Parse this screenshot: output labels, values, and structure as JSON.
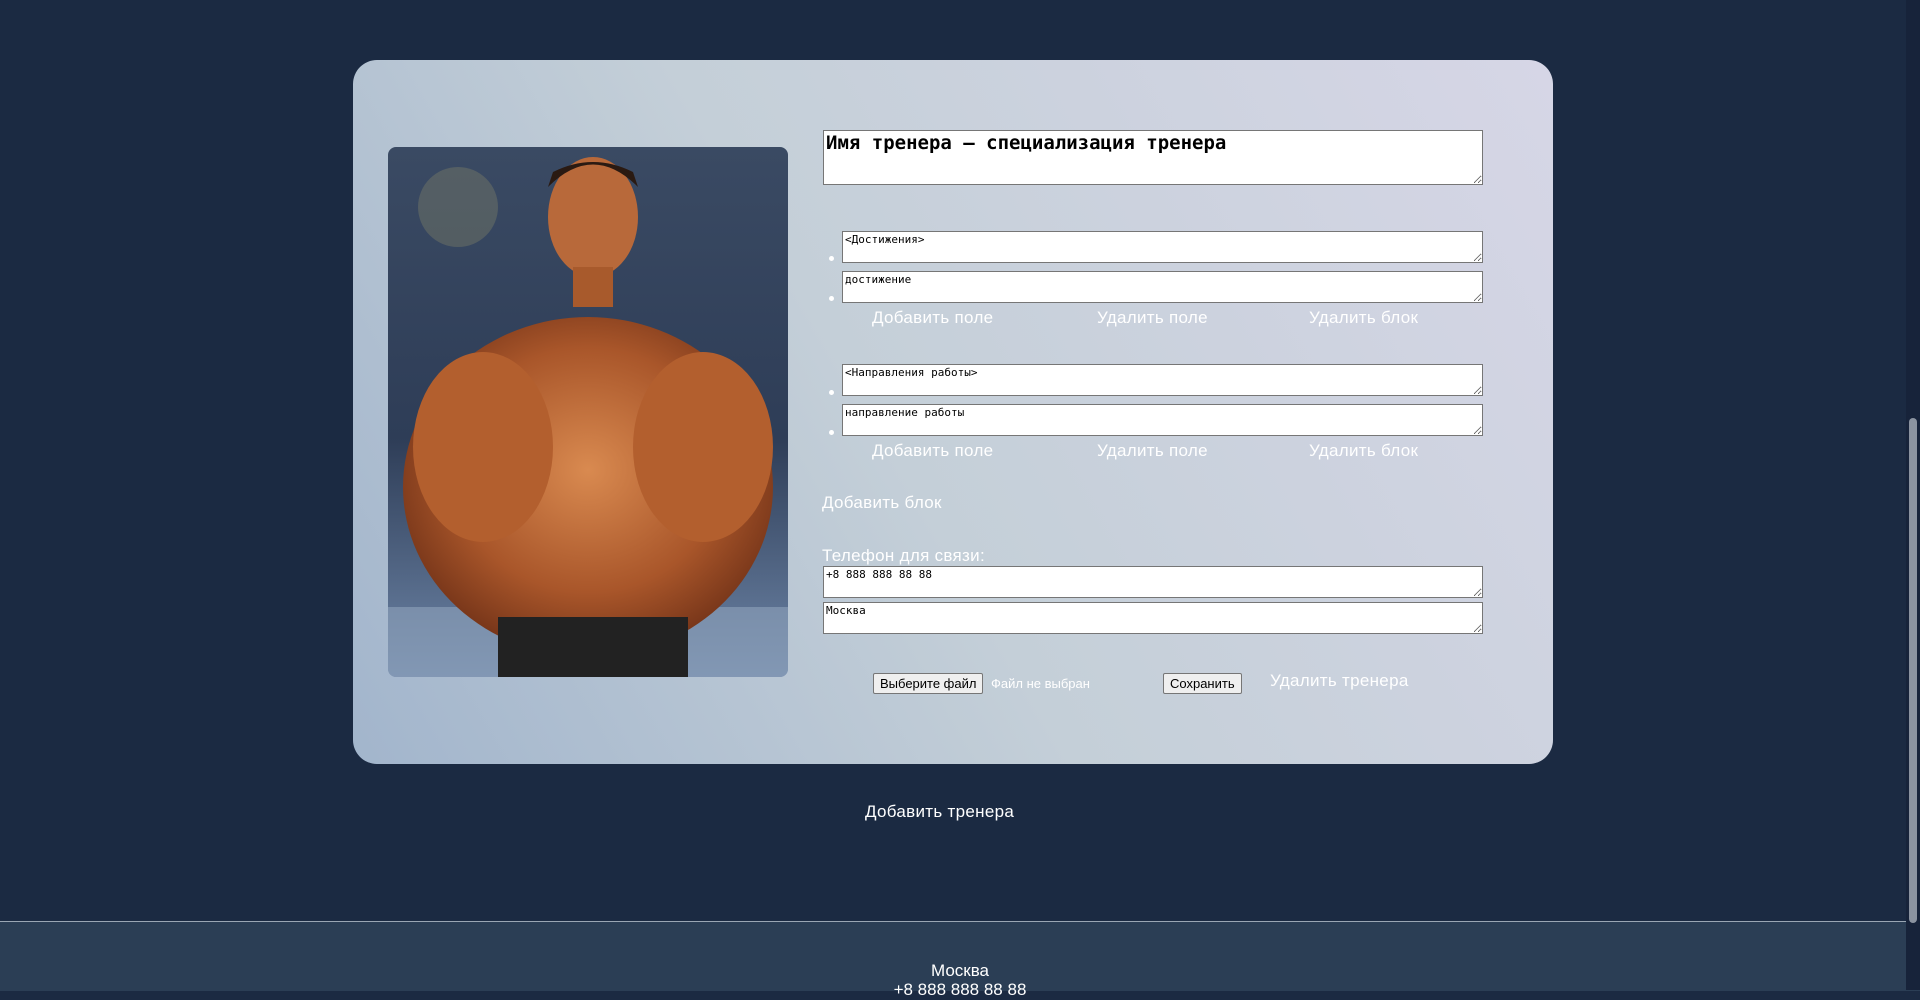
{
  "trainer_card": {
    "title": "Имя тренера — специализация тренера",
    "achievements_block": {
      "header": "<Достижения>",
      "item": "достижение",
      "add_field": "Добавить поле",
      "remove_field": "Удалить поле",
      "remove_block": "Удалить блок"
    },
    "directions_block": {
      "header": "<Направления работы>",
      "item": "направление работы",
      "add_field": "Добавить поле",
      "remove_field": "Удалить поле",
      "remove_block": "Удалить блок"
    },
    "add_block": "Добавить блок",
    "phone_label": "Телефон для связи:",
    "phone": "+8 888 888 88 88",
    "city": "Москва",
    "file_button": "Выберите файл",
    "file_status": "Файл не выбран",
    "save_button": "Сохранить",
    "delete_trainer": "Удалить тренера"
  },
  "add_trainer": "Добавить тренера",
  "footer": {
    "city": "Москва",
    "phone": "+8 888 888 88 88"
  },
  "colors": {
    "page_background": "#1b2a42",
    "footer_background": "#2b3e55",
    "link_text": "#ffffff"
  },
  "icons": {
    "photo": "trainer-photo"
  }
}
